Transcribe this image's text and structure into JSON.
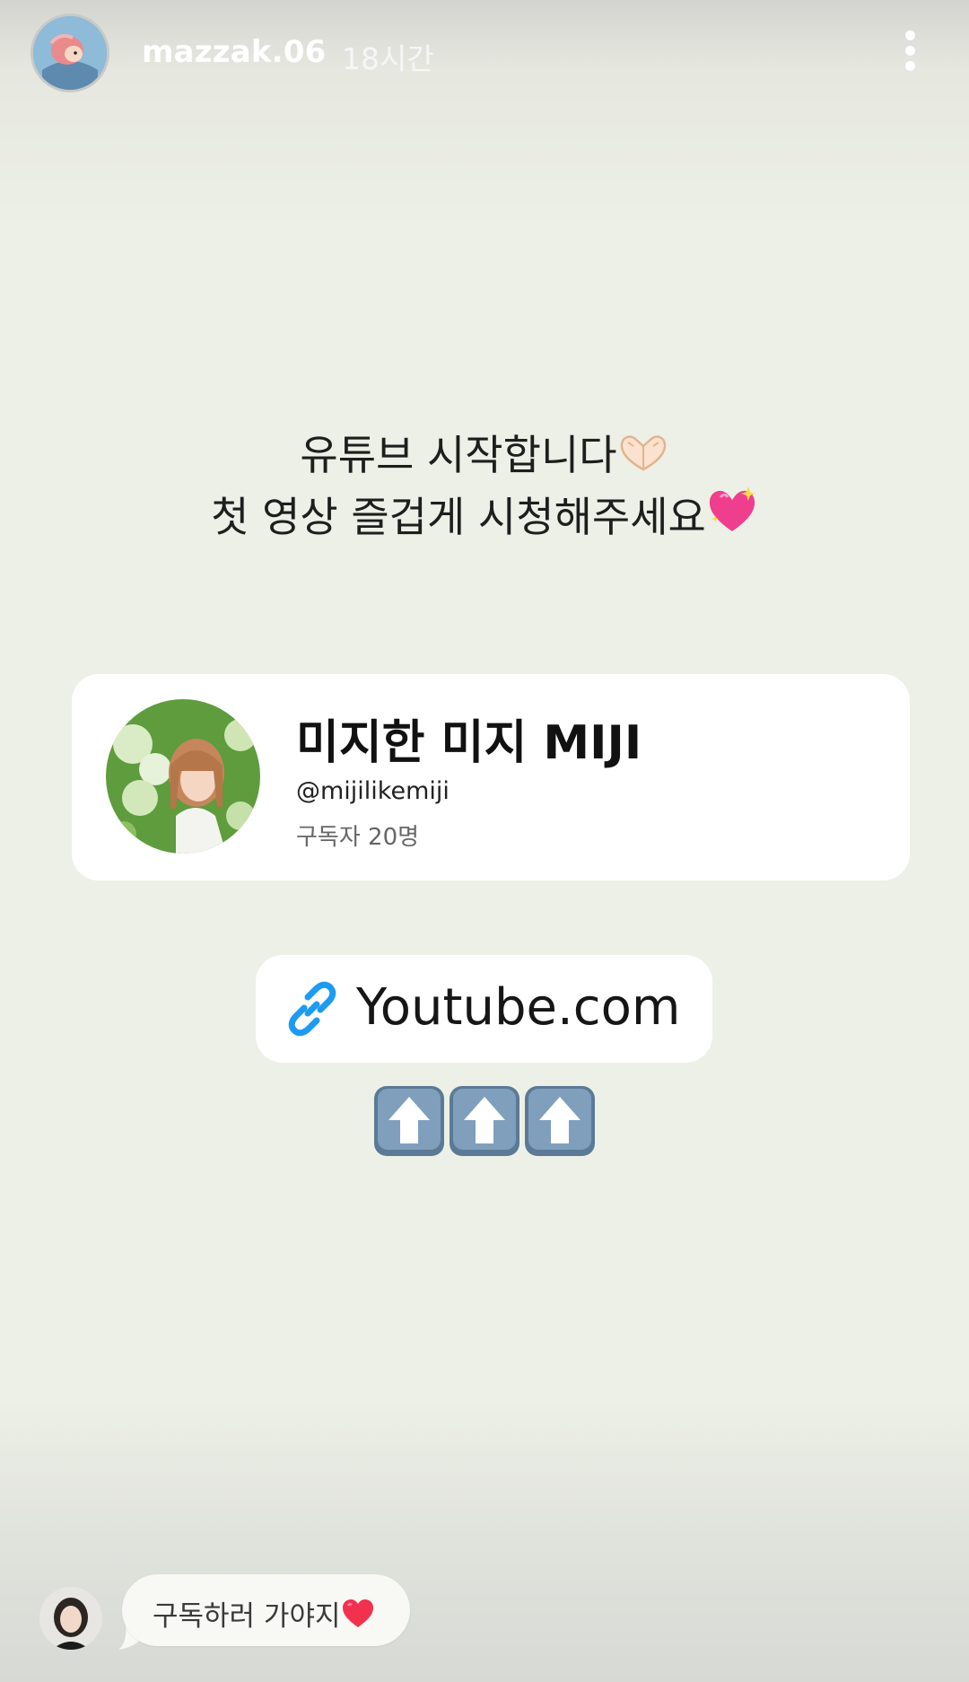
{
  "story_header": {
    "username": "mazzak.06",
    "time_ago": "18시간",
    "more_icon": "more-vertical-icon"
  },
  "caption": {
    "line1": "유튜브 시작합니다",
    "line1_emoji": "heart-hands-emoji",
    "line2": "첫 영상 즐겁게 시청해주세요",
    "line2_emoji": "sparkling-heart-emoji"
  },
  "profile_card": {
    "channel_name": "미지한 미지 MIJI",
    "handle": "@mijilikemiji",
    "subscribers": "구독자 20명"
  },
  "link_sticker": {
    "icon": "link-icon",
    "label": "Youtube.com",
    "icon_color": "#1d9bf0"
  },
  "arrows": {
    "count": 3,
    "icon": "up-arrow-emoji"
  },
  "reply": {
    "text": "구독하러 가야지",
    "emoji": "red-heart-emoji"
  }
}
